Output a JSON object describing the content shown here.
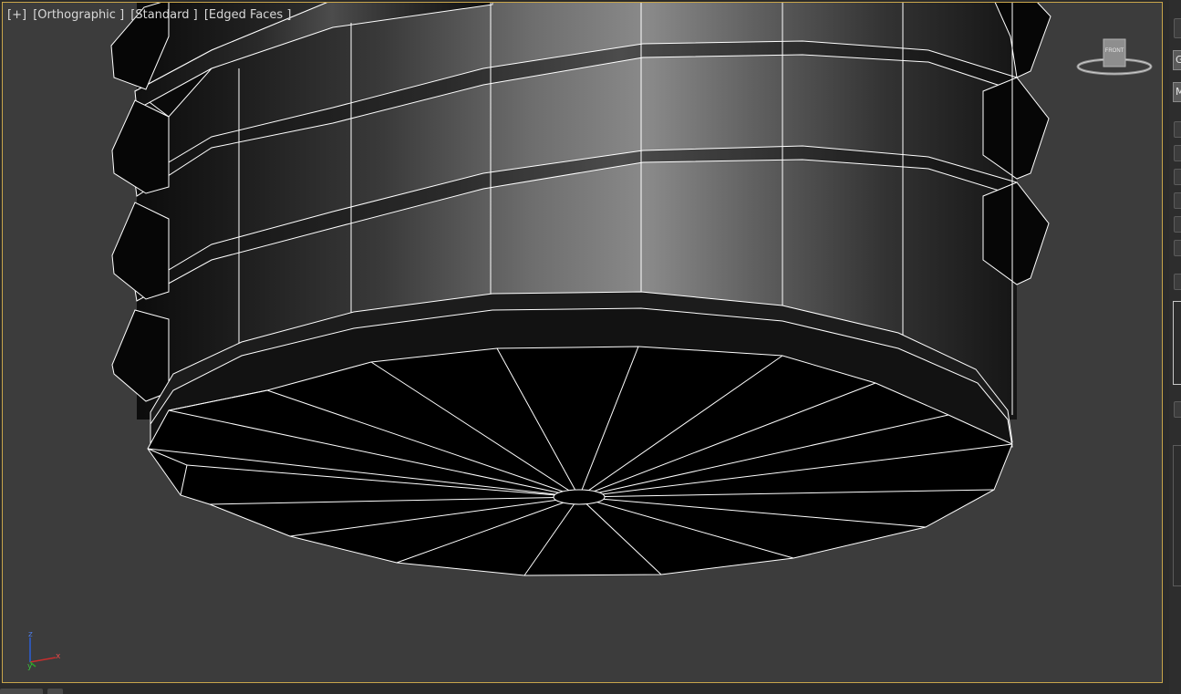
{
  "viewport": {
    "label_parts": [
      "[+]",
      "[Orthographic ]",
      "[Standard ]",
      "[Edged Faces ]"
    ],
    "border_color": "#c8a54b",
    "background_color": "#3c3c3c"
  },
  "viewcube": {
    "face_label": "FRONT"
  },
  "axis_tripod": {
    "z_label": "z",
    "x_label": "x",
    "y_label": "y"
  },
  "command_panel": {
    "field_1": "G",
    "field_2": "M"
  }
}
